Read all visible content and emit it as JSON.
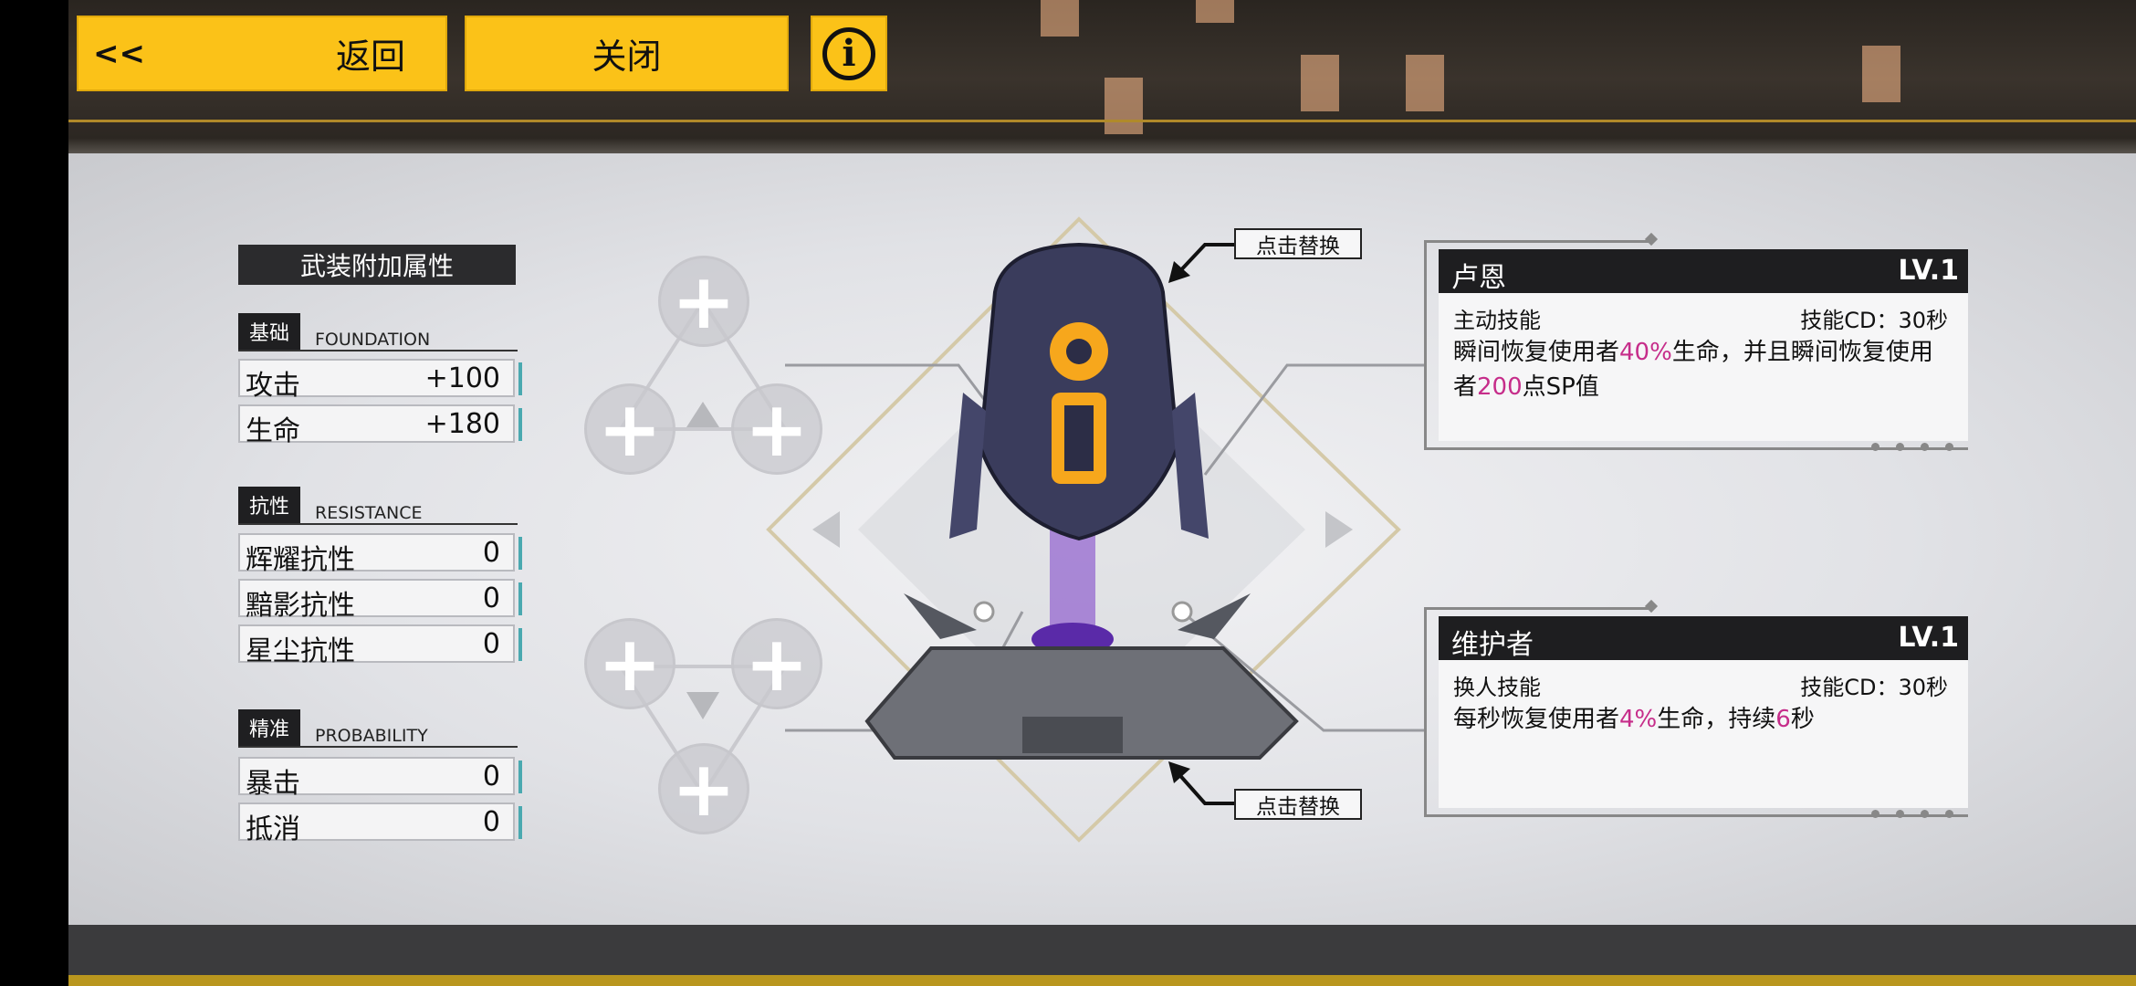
{
  "header": {
    "back_arrows": "<<",
    "back_label": "返回",
    "close_label": "关闭",
    "info_glyph": "i"
  },
  "stats": {
    "title": "武装附加属性",
    "sections": [
      {
        "tag": "基础",
        "en": "FOUNDATION",
        "rows": [
          {
            "k": "攻击",
            "v": "+100"
          },
          {
            "k": "生命",
            "v": "+180"
          }
        ]
      },
      {
        "tag": "抗性",
        "en": "RESISTANCE",
        "rows": [
          {
            "k": "辉耀抗性",
            "v": "0"
          },
          {
            "k": "黯影抗性",
            "v": "0"
          },
          {
            "k": "星尘抗性",
            "v": "0"
          }
        ]
      },
      {
        "tag": "精准",
        "en": "PROBABILITY",
        "rows": [
          {
            "k": "暴击",
            "v": "0"
          },
          {
            "k": "抵消",
            "v": "0"
          }
        ]
      }
    ]
  },
  "slots": {
    "plus_glyph": "+"
  },
  "callouts": {
    "top": "点击替换",
    "bottom": "点击替换"
  },
  "skills": [
    {
      "name": "卢恩",
      "level": "LV.1",
      "type": "主动技能",
      "cd": "技能CD：30秒",
      "desc_parts": [
        "瞬间恢复使用者",
        "40%",
        "生命，并且瞬间恢复使用者",
        "200",
        "点SP值"
      ]
    },
    {
      "name": "维护者",
      "level": "LV.1",
      "type": "换人技能",
      "cd": "技能CD：30秒",
      "desc_parts": [
        "每秒恢复使用者",
        "4%",
        "生命，持续",
        "6",
        "秒"
      ]
    }
  ],
  "colors": {
    "accent_yellow": "#fbc218",
    "highlight_pink": "#c62d8a",
    "teal_bar": "#4aa9b0"
  }
}
